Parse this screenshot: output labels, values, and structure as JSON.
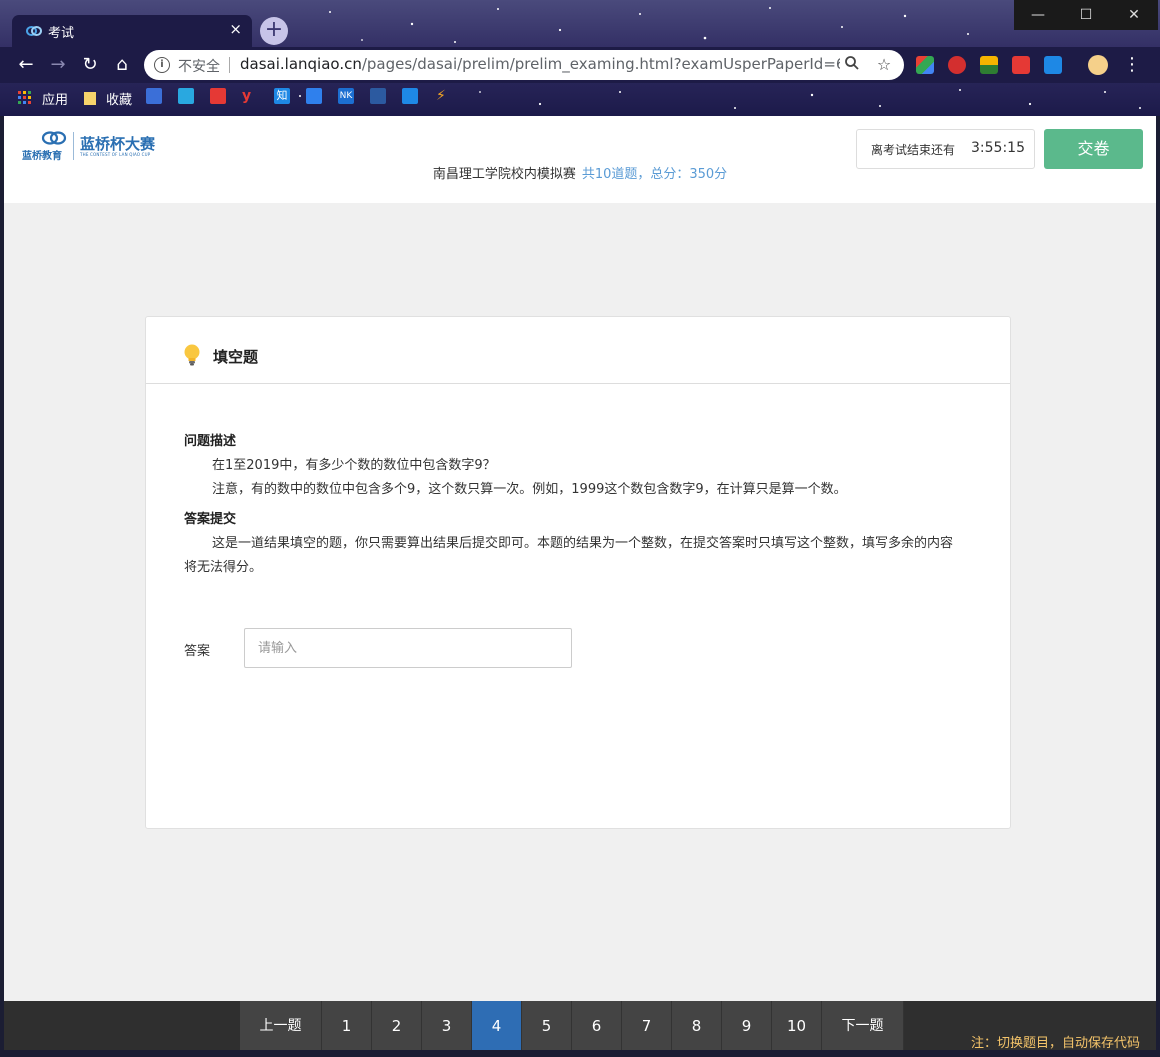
{
  "browser": {
    "tab_title": "考试",
    "tab_close": "×",
    "new_tab": "+",
    "window_buttons": {
      "minimize": "—",
      "maximize": "☐",
      "close": "✕"
    },
    "nav": {
      "back": "←",
      "forward": "→",
      "reload": "↻",
      "home": "⌂"
    },
    "address_bar": {
      "security_label": "不安全",
      "host": "dasai.lanqiao.cn",
      "path": "/pages/dasai/prelim/prelim_examing.html?examUsperPaperId=66030..."
    },
    "bookmarks": {
      "apps_label": "应用",
      "favorites_label": "收藏"
    }
  },
  "header": {
    "logo_left_text": "蓝桥教育",
    "logo_text": "蓝桥杯大赛",
    "logo_subtitle": "THE CONTEST OF LAN QIAO CUP",
    "exam_name": "南昌理工学院校内模拟赛",
    "exam_meta": "共10道题，总分：350分",
    "timer_label": "离考试结束还有",
    "timer_value": "3:55:15",
    "submit_label": "交卷"
  },
  "question": {
    "type_title": "填空题",
    "description_title": "问题描述",
    "description_lines": [
      "在1至2019中，有多少个数的数位中包含数字9？",
      "注意，有的数中的数位中包含多个9，这个数只算一次。例如，1999这个数包含数字9，在计算只是算一个数。"
    ],
    "submission_title": "答案提交",
    "submission_text": "这是一道结果填空的题，你只需要算出结果后提交即可。本题的结果为一个整数，在提交答案时只填写这个整数，填写多余的内容将无法得分。",
    "answer_label": "答案",
    "answer_placeholder": "请输入",
    "answer_value": ""
  },
  "pager": {
    "prev_label": "上一题",
    "next_label": "下一题",
    "pages": [
      "1",
      "2",
      "3",
      "4",
      "5",
      "6",
      "7",
      "8",
      "9",
      "10"
    ],
    "active_page": "4",
    "note": "注：切换题目，自动保存代码"
  },
  "colors": {
    "submit_button": "#5bb98c",
    "active_page": "#2e6db4",
    "exam_meta": "#5a9bd5",
    "note_text": "#f4c46a"
  }
}
